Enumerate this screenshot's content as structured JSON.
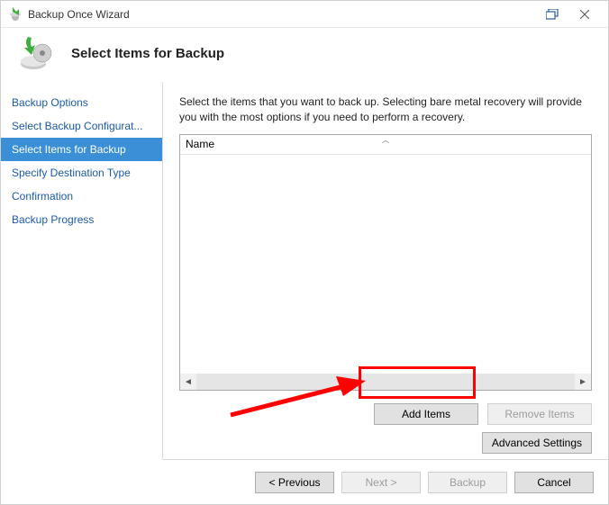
{
  "window": {
    "title": "Backup Once Wizard"
  },
  "header": {
    "title": "Select Items for Backup"
  },
  "sidebar": {
    "steps": [
      {
        "label": "Backup Options"
      },
      {
        "label": "Select Backup Configurat..."
      },
      {
        "label": "Select Items for Backup"
      },
      {
        "label": "Specify Destination Type"
      },
      {
        "label": "Confirmation"
      },
      {
        "label": "Backup Progress"
      }
    ],
    "active_index": 2
  },
  "main": {
    "instruction": "Select the items that you want to back up. Selecting bare metal recovery will provide you with the most options if you need to perform a recovery.",
    "list_header": "Name",
    "buttons": {
      "add_items": "Add Items",
      "remove_items": "Remove Items",
      "advanced_settings": "Advanced Settings"
    }
  },
  "footer": {
    "previous": "< Previous",
    "next": "Next >",
    "backup": "Backup",
    "cancel": "Cancel"
  }
}
